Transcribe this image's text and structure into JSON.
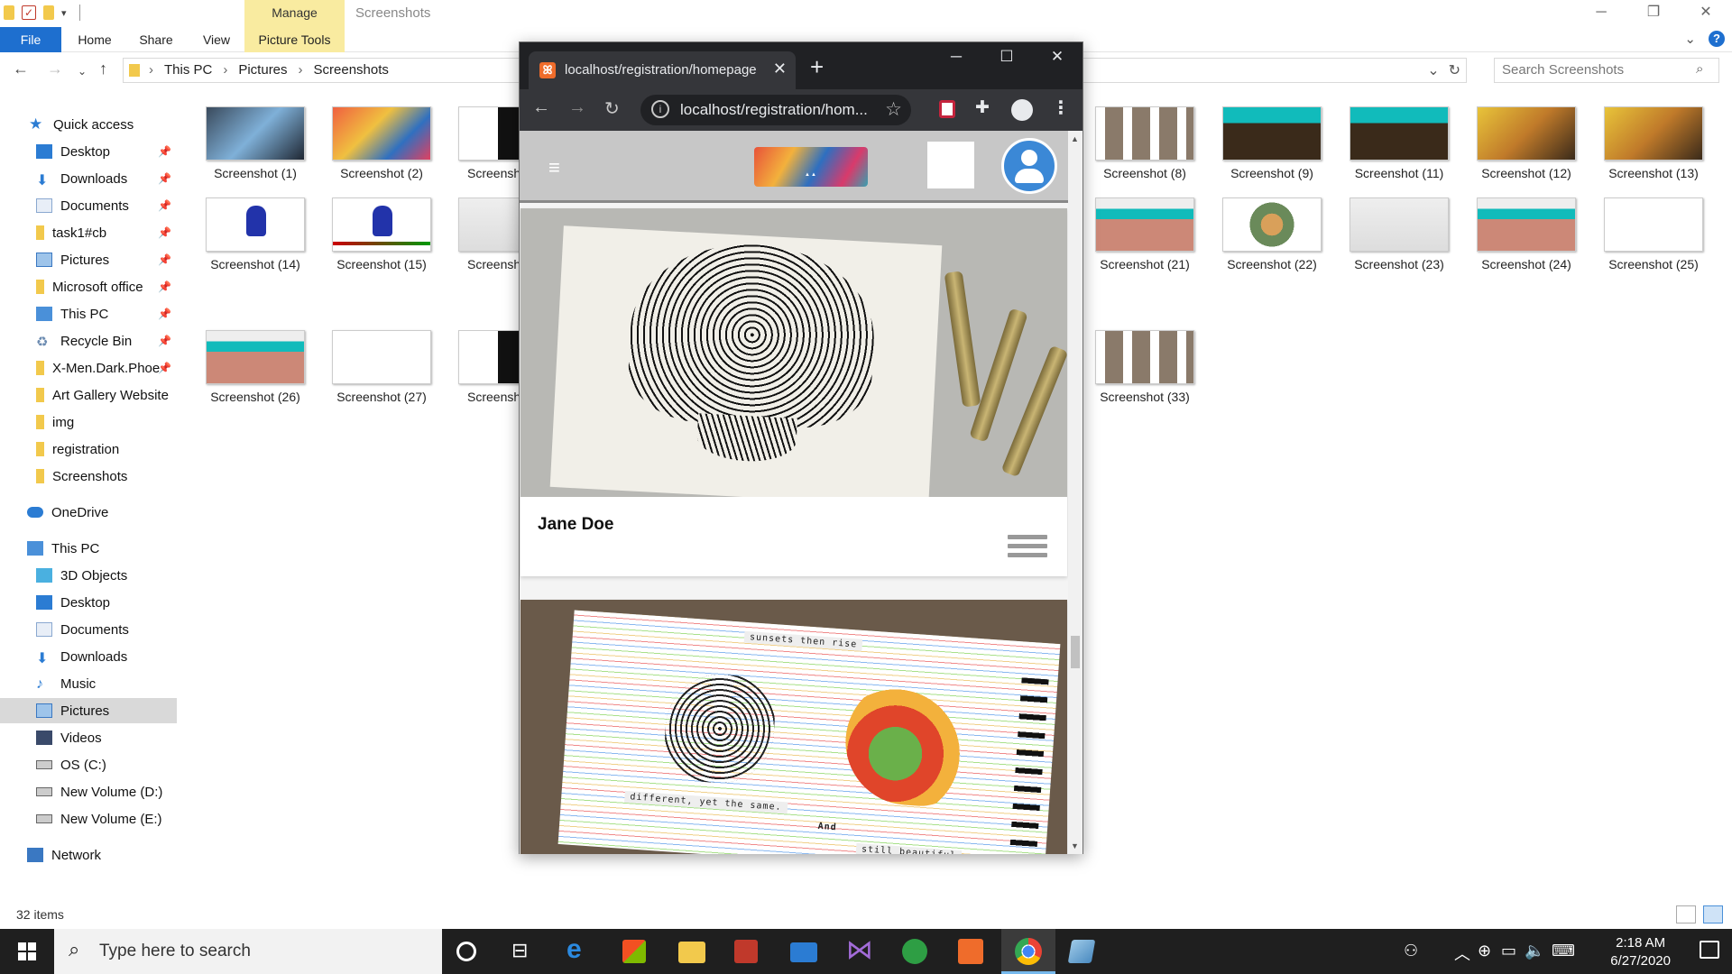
{
  "explorer": {
    "manage_tab": "Manage",
    "window_title": "Screenshots",
    "ribbon": [
      "File",
      "Home",
      "Share",
      "View"
    ],
    "picture_tools": "Picture Tools",
    "breadcrumb": [
      "This PC",
      "Pictures",
      "Screenshots"
    ],
    "search_placeholder": "Search Screenshots",
    "status": "32 items",
    "quick_access": "Quick access",
    "sidebar": [
      {
        "label": "Desktop",
        "pinned": true
      },
      {
        "label": "Downloads",
        "pinned": true
      },
      {
        "label": "Documents",
        "pinned": true
      },
      {
        "label": "task1#cb",
        "pinned": true
      },
      {
        "label": "Pictures",
        "pinned": true
      },
      {
        "label": "Microsoft office",
        "pinned": true
      },
      {
        "label": "This PC",
        "pinned": true
      },
      {
        "label": "Recycle Bin",
        "pinned": true
      },
      {
        "label": "X-Men.Dark.Phoe",
        "pinned": true
      },
      {
        "label": "Art Gallery Website",
        "pinned": false
      },
      {
        "label": "img",
        "pinned": false
      },
      {
        "label": "registration",
        "pinned": false
      },
      {
        "label": "Screenshots",
        "pinned": false
      }
    ],
    "onedrive": "OneDrive",
    "thispc": "This PC",
    "thispc_items": [
      "3D Objects",
      "Desktop",
      "Documents",
      "Downloads",
      "Music",
      "Pictures",
      "Videos",
      "OS (C:)",
      "New Volume (D:)",
      "New Volume (E:)"
    ],
    "network": "Network",
    "thumbnails": [
      {
        "label": "Screenshot (1)",
        "style": "ti-dark"
      },
      {
        "label": "Screenshot (2)",
        "style": "ti-art"
      },
      {
        "label": "Screensh",
        "style": "ti-bw"
      },
      {
        "label": "Screenshot (8)",
        "style": "ti-grid"
      },
      {
        "label": "Screenshot (9)",
        "style": "ti-green"
      },
      {
        "label": "Screenshot (11)",
        "style": "ti-green"
      },
      {
        "label": "Screenshot (12)",
        "style": "ti-yellow"
      },
      {
        "label": "Screenshot (13)",
        "style": "ti-yellow"
      },
      {
        "label": "Screenshot (14)",
        "style": "ti-stamp"
      },
      {
        "label": "Screenshot (15)",
        "style": "ti-stamp ti-stamp2"
      },
      {
        "label": "Screensh",
        "style": "ti-wire"
      },
      {
        "label": "Screenshot (21)",
        "style": "ti-mixed"
      },
      {
        "label": "Screenshot (22)",
        "style": "ti-mandala"
      },
      {
        "label": "Screenshot (23)",
        "style": "ti-wire"
      },
      {
        "label": "Screenshot (24)",
        "style": "ti-mixed"
      },
      {
        "label": "Screenshot (25)",
        "style": "ti-white"
      },
      {
        "label": "Screenshot (26)",
        "style": "ti-mixed"
      },
      {
        "label": "Screenshot (27)",
        "style": "ti-white"
      },
      {
        "label": "Screensh",
        "style": "ti-bw"
      },
      {
        "label": "Screenshot (33)",
        "style": "ti-grid"
      }
    ]
  },
  "chrome": {
    "tab_title": "localhost/registration/homepage",
    "url": "localhost/registration/hom...",
    "page": {
      "card1_name": "Jane Doe",
      "quote_top": "sunsets then rise",
      "quote_mid": "different, yet the same.",
      "quote_and": "And",
      "quote_bottom": "still beautiful"
    }
  },
  "taskbar": {
    "search_placeholder": "Type here to search",
    "time": "2:18 AM",
    "date": "6/27/2020"
  },
  "colors": {
    "accent": "#1e6fcf",
    "manage": "#f9eba0",
    "chrome_dark": "#202124",
    "avatar": "#3b88d6"
  }
}
